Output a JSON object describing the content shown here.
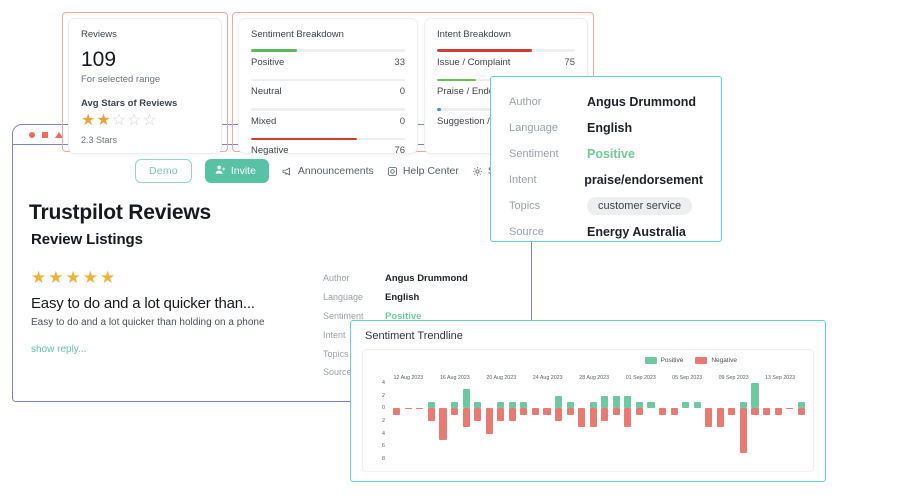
{
  "browser": {
    "titlebar_icons": [
      "circle-icon",
      "square-icon",
      "triangle-icon"
    ],
    "toolbar": {
      "demo_label": "Demo",
      "invite_label": "Invite",
      "announcements_label": "Announcements",
      "help_center_label": "Help Center",
      "settings_label": "Settings"
    },
    "page_title": "Trustpilot Reviews",
    "section_title": "Review Listings",
    "review": {
      "stars": "★★★★★",
      "star_count": 5,
      "heading": "Easy to do and a lot quicker than...",
      "body": "Easy to do and a lot quicker than holding on a phone",
      "show_reply_label": "show reply..."
    },
    "inline_meta": {
      "rows": [
        {
          "key": "Author",
          "value": "Angus Drummond"
        },
        {
          "key": "Language",
          "value": "English"
        },
        {
          "key": "Sentiment",
          "value": "Positive"
        },
        {
          "key": "Intent",
          "value": "praise/endorsement"
        },
        {
          "key": "Topics",
          "value": ""
        },
        {
          "key": "Source",
          "value": ""
        }
      ]
    }
  },
  "reviews_card": {
    "title": "Reviews",
    "count": "109",
    "range_label": "For selected range",
    "avg_stars_label": "Avg Stars of Reviews",
    "filled_stars": 2,
    "total_stars": 5,
    "avg_stars_text": "2.3 Stars"
  },
  "sentiment_card": {
    "title": "Sentiment Breakdown",
    "rows": [
      {
        "label": "Positive",
        "value": "33",
        "pct": 30,
        "color": "#5cb85c"
      },
      {
        "label": "Neutral",
        "value": "0",
        "pct": 0,
        "color": "#9aa1a9"
      },
      {
        "label": "Mixed",
        "value": "0",
        "pct": 0,
        "color": "#9aa1a9"
      },
      {
        "label": "Negative",
        "value": "76",
        "pct": 69,
        "color": "#cf3b36"
      }
    ]
  },
  "intent_card": {
    "title": "Intent Breakdown",
    "rows": [
      {
        "label": "Issue / Complaint",
        "value": "75",
        "pct": 69,
        "color": "#cf3b36"
      },
      {
        "label": "Praise / Endorsement",
        "value": "",
        "pct": 28,
        "color": "#6bbd5b"
      },
      {
        "label": "Suggestion / Request",
        "value": "",
        "pct": 3,
        "color": "#3b8ed0"
      }
    ]
  },
  "meta_popup": {
    "rows": [
      {
        "key": "Author",
        "value": "Angus Drummond",
        "style": "bold"
      },
      {
        "key": "Language",
        "value": "English",
        "style": "bold"
      },
      {
        "key": "Sentiment",
        "value": "Positive",
        "style": "positive"
      },
      {
        "key": "Intent",
        "value": "praise/endorsement",
        "style": "bold"
      },
      {
        "key": "Topics",
        "value": "customer service",
        "style": "chip"
      },
      {
        "key": "Source",
        "value": "Energy Australia",
        "style": "bold"
      }
    ]
  },
  "trendline": {
    "title": "Sentiment Trendline",
    "accent_color": "#5fd3cf"
  },
  "chart_data": {
    "type": "bar",
    "title": "Sentiment Trendline",
    "xlabel": "",
    "ylabel": "",
    "grid": false,
    "legend_position": "top-right",
    "ylim": [
      -8,
      4
    ],
    "yticks": [
      "4",
      "2",
      "0",
      "2",
      "4",
      "6",
      "8"
    ],
    "ytick_values": [
      4,
      2,
      0,
      -2,
      -4,
      -6,
      -8
    ],
    "xtick_labels": [
      "12 Aug 2023",
      "16 Aug 2023",
      "20 Aug 2023",
      "24 Aug 2023",
      "28 Aug 2023",
      "01 Sep 2023",
      "05 Sep 2023",
      "09 Sep 2023",
      "13 Sep 2023"
    ],
    "series": [
      {
        "name": "Positive",
        "color": "#6ec9a0",
        "values": [
          0,
          0,
          0,
          1,
          0,
          1,
          3,
          1,
          0,
          1,
          1,
          1,
          0,
          0,
          2,
          1,
          0,
          1,
          2,
          2,
          2,
          1,
          1,
          0,
          0,
          1,
          1,
          0,
          0,
          0,
          1,
          4,
          0,
          0,
          0,
          1
        ]
      },
      {
        "name": "Negative",
        "color": "#e77a72",
        "values": [
          -1,
          0,
          0,
          -2,
          -5,
          -1,
          -3,
          -2,
          -4,
          -2,
          -2,
          -1,
          -1,
          -1,
          -2,
          -1,
          -3,
          -3,
          -2,
          -1,
          -3,
          -1,
          0,
          -1,
          -1,
          0,
          0,
          -3,
          -3,
          -1,
          -7,
          -1,
          -1,
          -1,
          0,
          -1
        ]
      }
    ]
  }
}
